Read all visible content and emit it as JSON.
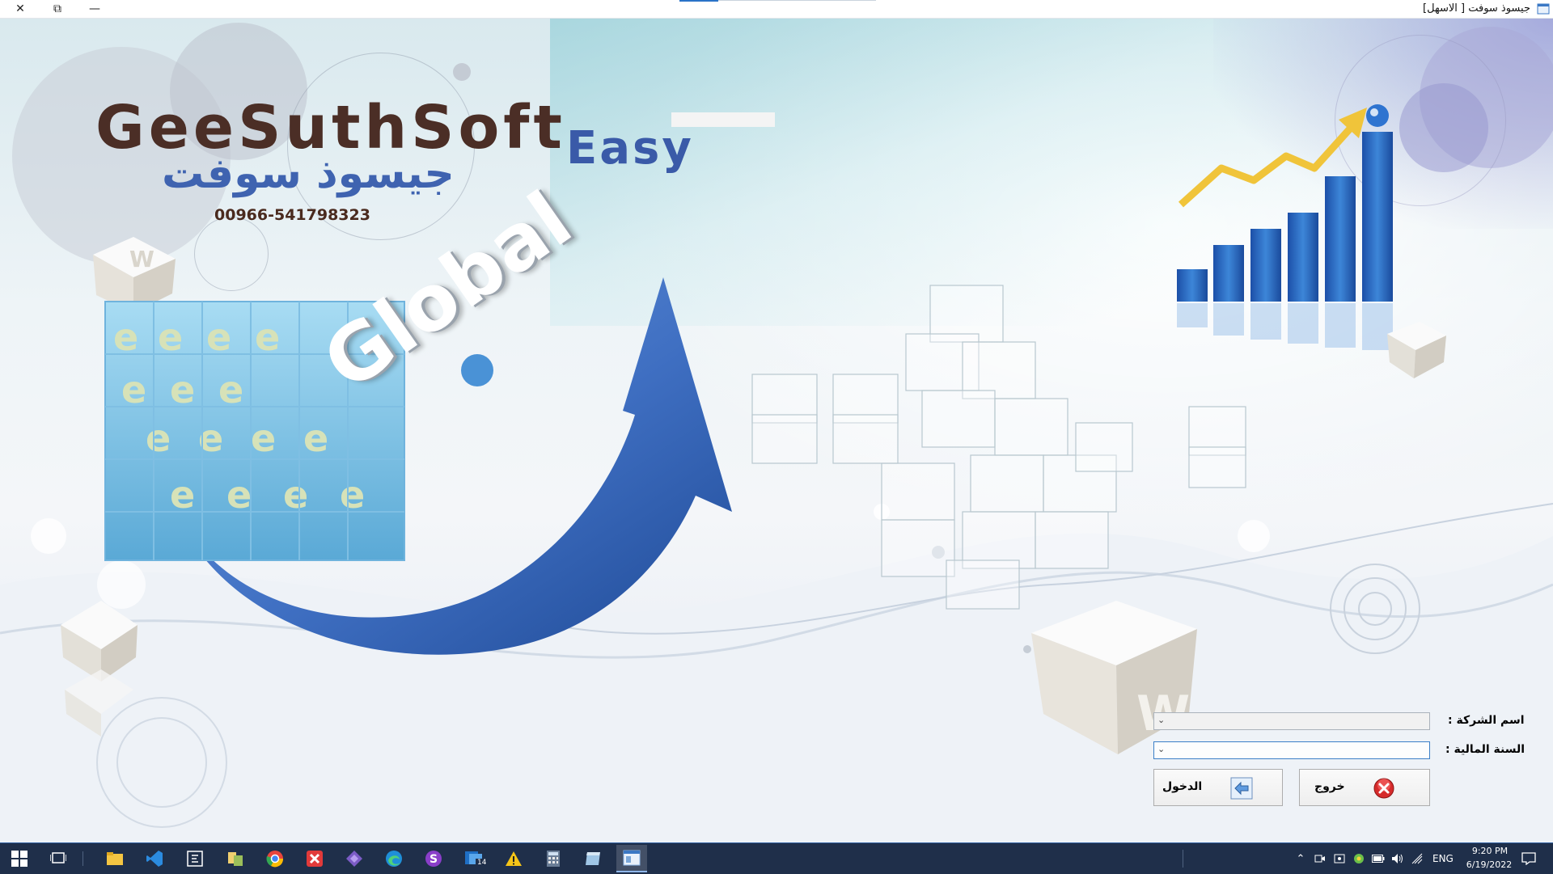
{
  "window": {
    "title": "جيسوذ سوفت [ الاسهل]",
    "close_glyph": "✕",
    "restore_glyph": "⧉",
    "minimize_glyph": "—"
  },
  "branding": {
    "name_en": "GeeSuthSoft",
    "edition": "Easy",
    "name_ar": "جيسوذ سوفت",
    "phone": "00966-541798323",
    "globe_word": "Global"
  },
  "login_form": {
    "company_label": "اسم الشركة :",
    "company_value": "",
    "fiscal_year_label": "السنة المالية :",
    "fiscal_year_value": "",
    "login_button": "الدخول",
    "exit_button": "خروج"
  },
  "taskbar": {
    "pinned": [
      "start-icon",
      "task-view-icon",
      "file-explorer-icon",
      "vscode-icon",
      "editor-icon",
      "git-tool-icon",
      "chrome-icon",
      "x-app-icon",
      "visual-studio-icon",
      "edge-icon",
      "s-app-icon",
      "outlook-icon",
      "warning-icon",
      "calculator-icon",
      "app-icon",
      "active-window-icon"
    ],
    "outlook_badge": "14",
    "language": "ENG",
    "time": "9:20 PM",
    "date": "6/19/2022"
  },
  "colors": {
    "taskbar": "#1f2f4a",
    "logo_brown": "#4b2e26",
    "logo_blue": "#3f63b0",
    "arrow_blue": "#3f6fc2",
    "chart_yellow": "#f0c43a"
  }
}
